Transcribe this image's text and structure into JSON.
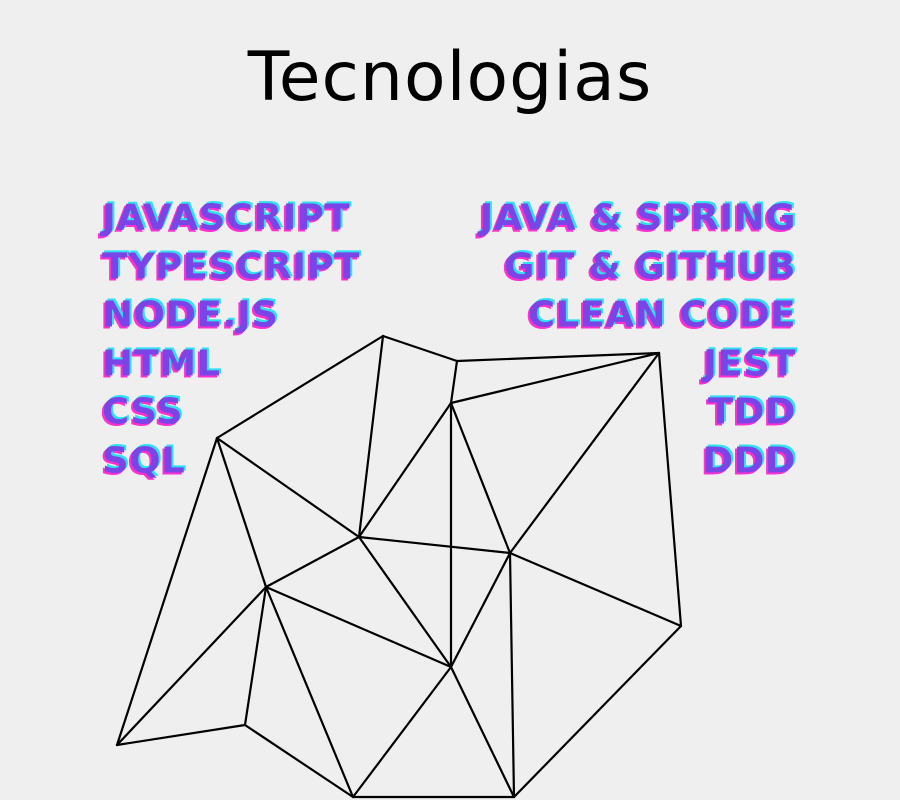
{
  "title": "Tecnologias",
  "left_technologies": [
    "JAVASCRIPT",
    "TYPESCRIPT",
    "NODE.JS",
    "HTML",
    "CSS",
    "SQL"
  ],
  "right_technologies": [
    "JAVA & SPRING",
    "GIT & GITHUB",
    "CLEAN CODE",
    "JEST",
    "TDD",
    "DDD"
  ],
  "colors": {
    "text": "#7a45e6",
    "shadow_cyan": "#2fe0f0",
    "shadow_magenta": "#ff2fd0",
    "background": "#efefef"
  }
}
